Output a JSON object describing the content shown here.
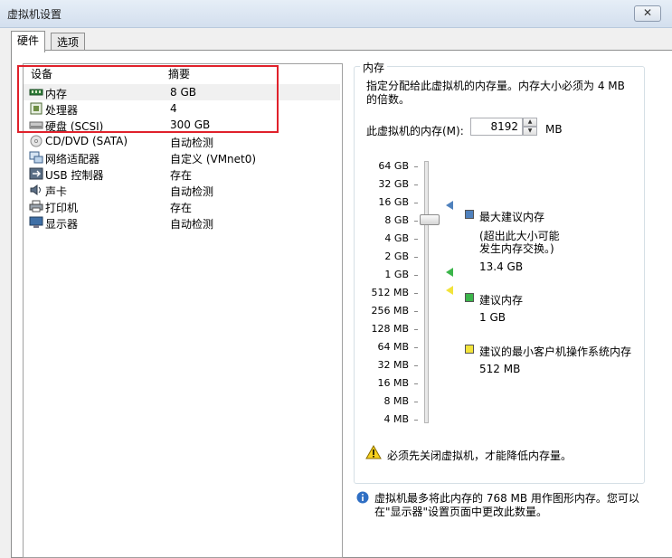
{
  "window": {
    "title": "虚拟机设置",
    "close_glyph": "✕"
  },
  "tabs": [
    {
      "label": "硬件"
    },
    {
      "label": "选项"
    }
  ],
  "devices": {
    "col_device": "设备",
    "col_summary": "摘要",
    "rows": [
      {
        "name": "内存",
        "summary": "8 GB",
        "icon": "memory-icon"
      },
      {
        "name": "处理器",
        "summary": "4",
        "icon": "processor-icon"
      },
      {
        "name": "硬盘 (SCSI)",
        "summary": "300 GB",
        "icon": "harddisk-icon"
      },
      {
        "name": "CD/DVD (SATA)",
        "summary": "自动检测",
        "icon": "cd-dvd-icon"
      },
      {
        "name": "网络适配器",
        "summary": "自定义 (VMnet0)",
        "icon": "network-icon"
      },
      {
        "name": "USB 控制器",
        "summary": "存在",
        "icon": "usb-icon"
      },
      {
        "name": "声卡",
        "summary": "自动检测",
        "icon": "sound-icon"
      },
      {
        "name": "打印机",
        "summary": "存在",
        "icon": "printer-icon"
      },
      {
        "name": "显示器",
        "summary": "自动检测",
        "icon": "display-icon"
      }
    ]
  },
  "memory": {
    "group_title": "内存",
    "description": "指定分配给此虚拟机的内存量。内存大小必须为 4 MB 的倍数。",
    "input_label": "此虚拟机的内存(M):",
    "value": "8192",
    "unit": "MB",
    "scale": [
      "64 GB",
      "32 GB",
      "16 GB",
      "8 GB",
      "4 GB",
      "2 GB",
      "1 GB",
      "512 MB",
      "256 MB",
      "128 MB",
      "64 MB",
      "32 MB",
      "16 MB",
      "8 MB",
      "4 MB"
    ],
    "max_recommended": {
      "label": "最大建议内存",
      "note_line1": "(超出此大小可能",
      "note_line2": "发生内存交换。)",
      "value": "13.4 GB",
      "color": "#4f81bd"
    },
    "recommended": {
      "label": "建议内存",
      "value": "1 GB",
      "color": "#3bb54a"
    },
    "min_guest_os": {
      "label": "建议的最小客户机操作系统内存",
      "value": "512 MB",
      "color": "#f2e33a"
    },
    "warning": "必须先关闭虚拟机，才能降低内存量。",
    "info_line1": "虚拟机最多将此内存的 768 MB 用作图形内存。您可以",
    "info_line2": "在\"显示器\"设置页面中更改此数量。"
  }
}
